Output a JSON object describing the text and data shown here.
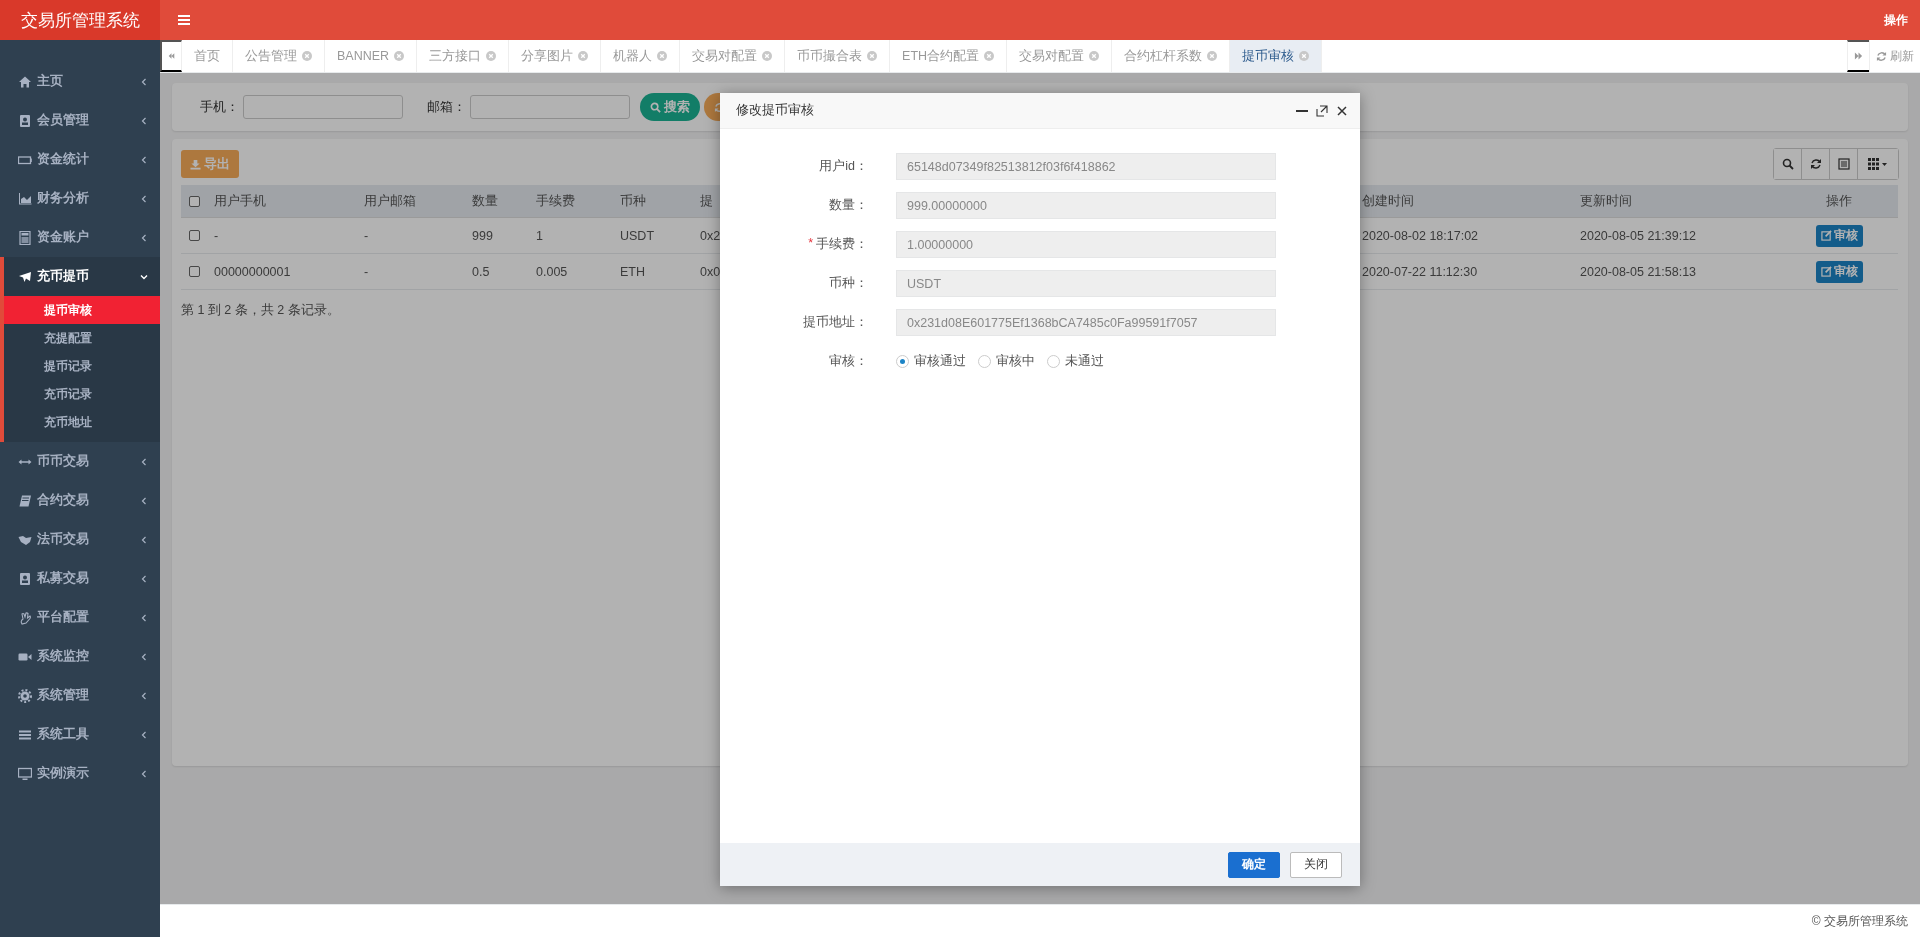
{
  "header": {
    "title": "交易所管理系统",
    "action": "操作"
  },
  "sidebar": {
    "items": [
      {
        "label": "主页",
        "expanded": false
      },
      {
        "label": "会员管理",
        "expanded": false
      },
      {
        "label": "资金统计",
        "expanded": false
      },
      {
        "label": "财务分析",
        "expanded": false
      },
      {
        "label": "资金账户",
        "expanded": false
      },
      {
        "label": "充币提币",
        "expanded": true,
        "children": [
          {
            "label": "提币审核",
            "selected": true
          },
          {
            "label": "充提配置",
            "selected": false
          },
          {
            "label": "提币记录",
            "selected": false
          },
          {
            "label": "充币记录",
            "selected": false
          },
          {
            "label": "充币地址",
            "selected": false
          }
        ]
      },
      {
        "label": "币币交易",
        "expanded": false
      },
      {
        "label": "合约交易",
        "expanded": false
      },
      {
        "label": "法币交易",
        "expanded": false
      },
      {
        "label": "私募交易",
        "expanded": false
      },
      {
        "label": "平台配置",
        "expanded": false
      },
      {
        "label": "系统监控",
        "expanded": false
      },
      {
        "label": "系统管理",
        "expanded": false
      },
      {
        "label": "系统工具",
        "expanded": false
      },
      {
        "label": "实例演示",
        "expanded": false
      }
    ]
  },
  "tabs": [
    {
      "label": "首页",
      "selected": false,
      "closable": false
    },
    {
      "label": "公告管理",
      "selected": false,
      "closable": true
    },
    {
      "label": "BANNER",
      "selected": false,
      "closable": true
    },
    {
      "label": "三方接口",
      "selected": false,
      "closable": true
    },
    {
      "label": "分享图片",
      "selected": false,
      "closable": true
    },
    {
      "label": "机器人",
      "selected": false,
      "closable": true
    },
    {
      "label": "交易对配置",
      "selected": false,
      "closable": true
    },
    {
      "label": "币币撮合表",
      "selected": false,
      "closable": true
    },
    {
      "label": "ETH合约配置",
      "selected": false,
      "closable": true
    },
    {
      "label": "交易对配置",
      "selected": false,
      "closable": true
    },
    {
      "label": "合约杠杆系数",
      "selected": false,
      "closable": true
    },
    {
      "label": "提币审核",
      "selected": true,
      "closable": true
    }
  ],
  "refresh": "刷新",
  "search": {
    "fields": [
      {
        "label": "手机："
      },
      {
        "label": "邮箱："
      }
    ],
    "search_button": "搜索"
  },
  "export_button": "导出",
  "table": {
    "select_all": {
      "checked": false
    },
    "columns": [
      "用户手机",
      "用户邮箱",
      "数量",
      "手续费",
      "币种",
      "提",
      "创建时间",
      "更新时间",
      "操作"
    ],
    "rows": [
      {
        "checked": false,
        "cells": [
          "-",
          "-",
          "999",
          "1",
          "USDT",
          "0x2",
          "2020-08-02 18:17:02",
          "2020-08-05 21:39:12"
        ],
        "action": "审核"
      },
      {
        "checked": false,
        "cells": [
          "00000000001",
          "-",
          "0.5",
          "0.005",
          "ETH",
          "0x0",
          "2020-07-22 11:12:30",
          "2020-08-05 21:58:13"
        ],
        "action": "审核"
      }
    ]
  },
  "pagination": "第 1 到 2 条，共 2 条记录。",
  "modal": {
    "title": "修改提币审核",
    "fields": [
      {
        "label": "用户id：",
        "value": "65148d07349f82513812f03f6f418862"
      },
      {
        "label": "数量：",
        "value": "999.00000000"
      },
      {
        "label": "手续费：",
        "value": "1.00000000",
        "required_mark": "*"
      },
      {
        "label": "币种：",
        "value": "USDT"
      },
      {
        "label": "提币地址：",
        "value": "0x231d08E601775Ef1368bCA7485c0Fa99591f7057"
      }
    ],
    "review": {
      "label": "审核：",
      "options": [
        {
          "label": "审核通过",
          "selected": true
        },
        {
          "label": "审核中",
          "selected": false
        },
        {
          "label": "未通过",
          "selected": false
        }
      ]
    },
    "confirm_button": "确定",
    "close_button": "关闭"
  },
  "footer": "© 交易所管理系统"
}
